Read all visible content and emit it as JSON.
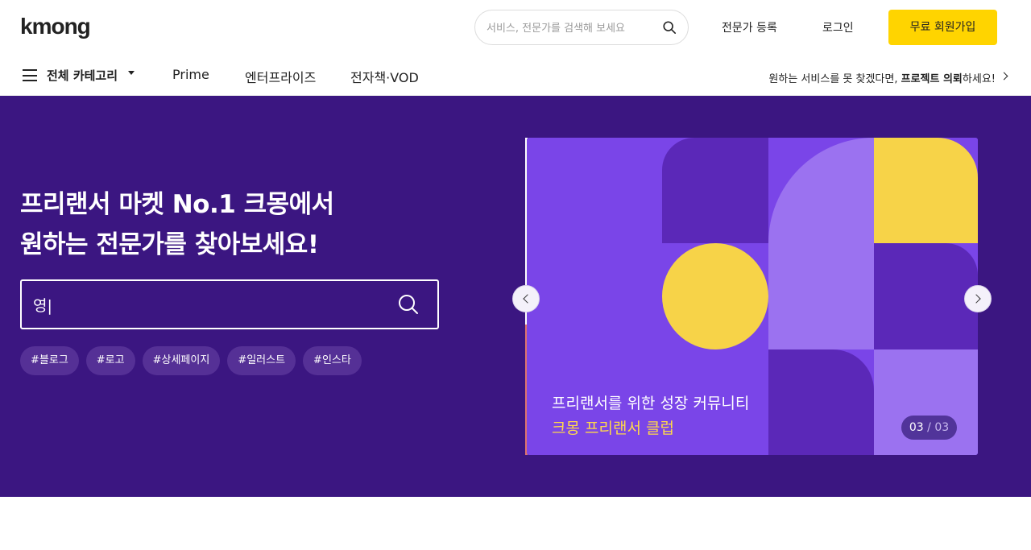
{
  "header": {
    "logo": "kmong",
    "search_placeholder": "서비스, 전문가를 검색해 보세요",
    "expert_register": "전문가 등록",
    "login": "로그인",
    "signup": "무료 회원가입"
  },
  "subnav": {
    "all_categories": "전체 카테고리",
    "items": [
      "Prime",
      "엔터프라이즈",
      "전자책·VOD"
    ],
    "request_prefix": "원하는 서비스를 못 찾겠다면, ",
    "request_bold": "프로젝트 의뢰",
    "request_suffix": "하세요!"
  },
  "hero": {
    "title_line1": "프리랜서 마켓 No.1 크몽에서",
    "title_line2": "원하는 전문가를 찾아보세요!",
    "search_value": "영|",
    "tags": [
      "#블로그",
      "#로고",
      "#상세페이지",
      "#일러스트",
      "#인스타"
    ]
  },
  "banner": {
    "line1": "프리랜서를 위한 성장 커뮤니티",
    "line2": "크몽 프리랜서 클럽",
    "current": "03",
    "separator": " / ",
    "total": "03",
    "progress": 0.41,
    "colors": {
      "background": "#7a45e8",
      "dark_purple": "#5b28b8",
      "light_purple": "#9b72f0",
      "yellow": "#f7d348"
    }
  },
  "colors": {
    "hero_bg": "#3b1681",
    "accent_yellow": "#ffd400"
  }
}
